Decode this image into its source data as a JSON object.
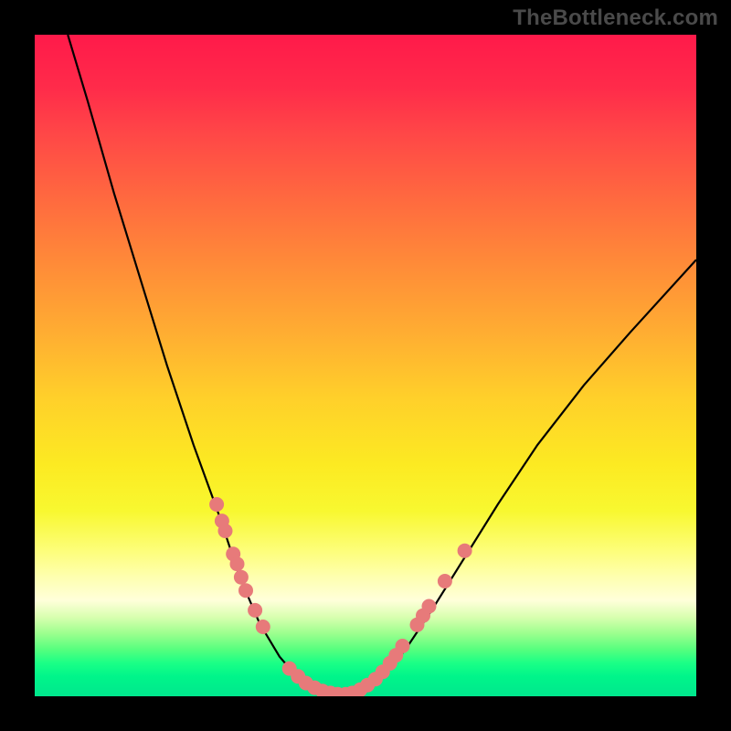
{
  "watermark": "TheBottleneck.com",
  "chart_data": {
    "type": "line",
    "title": "",
    "xlabel": "",
    "ylabel": "",
    "xlim": [
      0,
      100
    ],
    "ylim": [
      0,
      100
    ],
    "grid": false,
    "legend": false,
    "notes": "Bottleneck curve heatmap. No axis ticks or numeric labels are rendered. Background gradient encodes bottleneck severity from red (top, high) to green (bottom, low). Black V-shaped curve with salmon-colored data point clusters near the trough.",
    "background_gradient_stops": [
      {
        "pos": 0,
        "color": "#ff1a4a"
      },
      {
        "pos": 50,
        "color": "#ffd02a"
      },
      {
        "pos": 85,
        "color": "#ffffda"
      },
      {
        "pos": 100,
        "color": "#00e78d"
      }
    ],
    "curve_samples_xy_percent": [
      [
        5,
        100
      ],
      [
        8,
        90
      ],
      [
        12,
        76
      ],
      [
        16,
        63
      ],
      [
        20,
        50
      ],
      [
        24,
        38
      ],
      [
        28,
        27
      ],
      [
        31,
        18
      ],
      [
        34,
        11
      ],
      [
        37,
        6
      ],
      [
        40,
        2.5
      ],
      [
        43,
        0.8
      ],
      [
        46,
        0.2
      ],
      [
        49,
        0.8
      ],
      [
        52,
        2.5
      ],
      [
        56,
        7
      ],
      [
        60,
        13
      ],
      [
        65,
        21
      ],
      [
        70,
        29
      ],
      [
        76,
        38
      ],
      [
        83,
        47
      ],
      [
        90,
        55
      ],
      [
        100,
        66
      ]
    ],
    "marker_points_xy_percent": [
      [
        27.5,
        29
      ],
      [
        28.3,
        26.5
      ],
      [
        28.8,
        25
      ],
      [
        30.0,
        21.5
      ],
      [
        30.6,
        20
      ],
      [
        31.2,
        18
      ],
      [
        31.9,
        16
      ],
      [
        33.3,
        13
      ],
      [
        34.5,
        10.5
      ],
      [
        38.5,
        4.2
      ],
      [
        39.8,
        3.0
      ],
      [
        41.0,
        2.0
      ],
      [
        42.3,
        1.3
      ],
      [
        43.5,
        0.8
      ],
      [
        44.7,
        0.5
      ],
      [
        45.8,
        0.3
      ],
      [
        47.0,
        0.3
      ],
      [
        48.0,
        0.5
      ],
      [
        49.2,
        1.0
      ],
      [
        50.3,
        1.7
      ],
      [
        51.5,
        2.6
      ],
      [
        52.6,
        3.7
      ],
      [
        53.7,
        5.0
      ],
      [
        54.6,
        6.2
      ],
      [
        55.6,
        7.6
      ],
      [
        57.8,
        10.8
      ],
      [
        58.7,
        12.2
      ],
      [
        59.6,
        13.6
      ],
      [
        62.0,
        17.4
      ],
      [
        65.0,
        22.0
      ]
    ],
    "curve_color": "#000000",
    "marker_color": "#e77a7a",
    "marker_radius_px": 8
  }
}
